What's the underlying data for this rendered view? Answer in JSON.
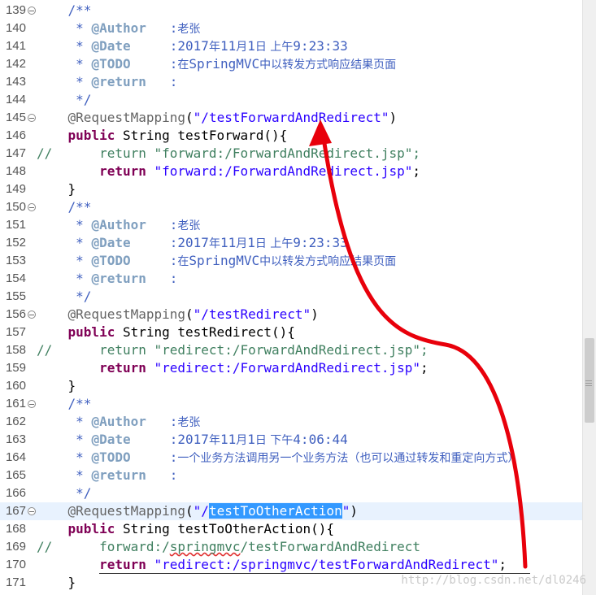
{
  "editor": {
    "lines": [
      {
        "num": "139",
        "fold": true,
        "tokens": [
          {
            "t": "    "
          },
          {
            "t": "/**",
            "c": "doc"
          }
        ]
      },
      {
        "num": "140",
        "tokens": [
          {
            "t": "     * ",
            "c": "doc"
          },
          {
            "t": "@Author",
            "c": "tag"
          },
          {
            "t": "   :",
            "c": "doc"
          },
          {
            "t": "老张",
            "c": "doc",
            "cjk": true
          }
        ]
      },
      {
        "num": "141",
        "tokens": [
          {
            "t": "     * ",
            "c": "doc"
          },
          {
            "t": "@Date",
            "c": "tag"
          },
          {
            "t": "     :2017",
            "c": "doc"
          },
          {
            "t": "年",
            "c": "doc",
            "cjk": true
          },
          {
            "t": "11",
            "c": "doc"
          },
          {
            "t": "月",
            "c": "doc",
            "cjk": true
          },
          {
            "t": "1",
            "c": "doc"
          },
          {
            "t": "日 上午",
            "c": "doc",
            "cjk": true
          },
          {
            "t": "9:23:33",
            "c": "doc"
          }
        ]
      },
      {
        "num": "142",
        "tokens": [
          {
            "t": "     * ",
            "c": "doc"
          },
          {
            "t": "@TODO",
            "c": "tag"
          },
          {
            "t": "     :",
            "c": "doc"
          },
          {
            "t": "在",
            "c": "doc",
            "cjk": true
          },
          {
            "t": "SpringMVC",
            "c": "doc"
          },
          {
            "t": "中以转发方式响应结果页面",
            "c": "doc",
            "cjk": true
          }
        ]
      },
      {
        "num": "143",
        "tokens": [
          {
            "t": "     * ",
            "c": "doc"
          },
          {
            "t": "@return",
            "c": "tag"
          },
          {
            "t": "   :",
            "c": "doc"
          }
        ]
      },
      {
        "num": "144",
        "tokens": [
          {
            "t": "     */",
            "c": "doc"
          }
        ]
      },
      {
        "num": "145",
        "fold": true,
        "tokens": [
          {
            "t": "    "
          },
          {
            "t": "@RequestMapping",
            "c": "ann"
          },
          {
            "t": "(",
            "c": "id"
          },
          {
            "t": "\"/testForwardAndRedirect\"",
            "c": "str"
          },
          {
            "t": ")",
            "c": "id"
          }
        ]
      },
      {
        "num": "146",
        "tokens": [
          {
            "t": "    "
          },
          {
            "t": "public",
            "c": "kw"
          },
          {
            "t": " String testForward(){",
            "c": "id"
          }
        ]
      },
      {
        "num": "147",
        "tokens": [
          {
            "t": "//      return \"forward:/ForwardAndRedirect.jsp\";",
            "c": "com"
          }
        ]
      },
      {
        "num": "148",
        "tokens": [
          {
            "t": "        "
          },
          {
            "t": "return",
            "c": "kw"
          },
          {
            "t": " ",
            "c": "id"
          },
          {
            "t": "\"forward:/ForwardAndRedirect.jsp\"",
            "c": "str"
          },
          {
            "t": ";",
            "c": "id"
          }
        ]
      },
      {
        "num": "149",
        "tokens": [
          {
            "t": "    }",
            "c": "id"
          }
        ]
      },
      {
        "num": "150",
        "fold": true,
        "tokens": [
          {
            "t": "    "
          },
          {
            "t": "/**",
            "c": "doc"
          }
        ]
      },
      {
        "num": "151",
        "tokens": [
          {
            "t": "     * ",
            "c": "doc"
          },
          {
            "t": "@Author",
            "c": "tag"
          },
          {
            "t": "   :",
            "c": "doc"
          },
          {
            "t": "老张",
            "c": "doc",
            "cjk": true
          }
        ]
      },
      {
        "num": "152",
        "tokens": [
          {
            "t": "     * ",
            "c": "doc"
          },
          {
            "t": "@Date",
            "c": "tag"
          },
          {
            "t": "     :2017",
            "c": "doc"
          },
          {
            "t": "年",
            "c": "doc",
            "cjk": true
          },
          {
            "t": "11",
            "c": "doc"
          },
          {
            "t": "月",
            "c": "doc",
            "cjk": true
          },
          {
            "t": "1",
            "c": "doc"
          },
          {
            "t": "日 上午",
            "c": "doc",
            "cjk": true
          },
          {
            "t": "9:23:33",
            "c": "doc"
          }
        ]
      },
      {
        "num": "153",
        "tokens": [
          {
            "t": "     * ",
            "c": "doc"
          },
          {
            "t": "@TODO",
            "c": "tag"
          },
          {
            "t": "     :",
            "c": "doc"
          },
          {
            "t": "在",
            "c": "doc",
            "cjk": true
          },
          {
            "t": "SpringMVC",
            "c": "doc"
          },
          {
            "t": "中以转发方式响应结果页面",
            "c": "doc",
            "cjk": true
          }
        ]
      },
      {
        "num": "154",
        "tokens": [
          {
            "t": "     * ",
            "c": "doc"
          },
          {
            "t": "@return",
            "c": "tag"
          },
          {
            "t": "   :",
            "c": "doc"
          }
        ]
      },
      {
        "num": "155",
        "tokens": [
          {
            "t": "     */",
            "c": "doc"
          }
        ]
      },
      {
        "num": "156",
        "fold": true,
        "tokens": [
          {
            "t": "    "
          },
          {
            "t": "@RequestMapping",
            "c": "ann"
          },
          {
            "t": "(",
            "c": "id"
          },
          {
            "t": "\"/testRedirect\"",
            "c": "str"
          },
          {
            "t": ")",
            "c": "id"
          }
        ]
      },
      {
        "num": "157",
        "tokens": [
          {
            "t": "    "
          },
          {
            "t": "public",
            "c": "kw"
          },
          {
            "t": " String testRedirect(){",
            "c": "id"
          }
        ]
      },
      {
        "num": "158",
        "tokens": [
          {
            "t": "//      return \"redirect:/ForwardAndRedirect.jsp\";",
            "c": "com"
          }
        ]
      },
      {
        "num": "159",
        "tokens": [
          {
            "t": "        "
          },
          {
            "t": "return",
            "c": "kw"
          },
          {
            "t": " ",
            "c": "id"
          },
          {
            "t": "\"redirect:/ForwardAndRedirect.jsp\"",
            "c": "str"
          },
          {
            "t": ";",
            "c": "id"
          }
        ]
      },
      {
        "num": "160",
        "tokens": [
          {
            "t": "    }",
            "c": "id"
          }
        ]
      },
      {
        "num": "161",
        "fold": true,
        "tokens": [
          {
            "t": "    "
          },
          {
            "t": "/**",
            "c": "doc"
          }
        ]
      },
      {
        "num": "162",
        "tokens": [
          {
            "t": "     * ",
            "c": "doc"
          },
          {
            "t": "@Author",
            "c": "tag"
          },
          {
            "t": "   :",
            "c": "doc"
          },
          {
            "t": "老张",
            "c": "doc",
            "cjk": true
          }
        ]
      },
      {
        "num": "163",
        "tokens": [
          {
            "t": "     * ",
            "c": "doc"
          },
          {
            "t": "@Date",
            "c": "tag"
          },
          {
            "t": "     :2017",
            "c": "doc"
          },
          {
            "t": "年",
            "c": "doc",
            "cjk": true
          },
          {
            "t": "11",
            "c": "doc"
          },
          {
            "t": "月",
            "c": "doc",
            "cjk": true
          },
          {
            "t": "1",
            "c": "doc"
          },
          {
            "t": "日 下午",
            "c": "doc",
            "cjk": true
          },
          {
            "t": "4:06:44",
            "c": "doc"
          }
        ]
      },
      {
        "num": "164",
        "tokens": [
          {
            "t": "     * ",
            "c": "doc"
          },
          {
            "t": "@TODO",
            "c": "tag"
          },
          {
            "t": "     :",
            "c": "doc"
          },
          {
            "t": "一个业务方法调用另一个业务方法（也可以通过转发和重定向方式）",
            "c": "doc",
            "cjk": true
          }
        ]
      },
      {
        "num": "165",
        "tokens": [
          {
            "t": "     * ",
            "c": "doc"
          },
          {
            "t": "@return",
            "c": "tag"
          },
          {
            "t": "   :",
            "c": "doc"
          }
        ]
      },
      {
        "num": "166",
        "tokens": [
          {
            "t": "     */",
            "c": "doc"
          }
        ]
      },
      {
        "num": "167",
        "fold": true,
        "current": true,
        "tokens": [
          {
            "t": "    "
          },
          {
            "t": "@RequestMapping",
            "c": "ann"
          },
          {
            "t": "(",
            "c": "id"
          },
          {
            "t": "\"/",
            "c": "str"
          },
          {
            "t": "testToOtherAction",
            "c": "sel"
          },
          {
            "t": "\"",
            "c": "str"
          },
          {
            "t": ")",
            "c": "id"
          }
        ]
      },
      {
        "num": "168",
        "tokens": [
          {
            "t": "    "
          },
          {
            "t": "public",
            "c": "kw"
          },
          {
            "t": " String testToOtherAction(){",
            "c": "id"
          }
        ]
      },
      {
        "num": "169",
        "tokens": [
          {
            "t": "//      forward:/",
            "c": "com"
          },
          {
            "t": "springmvc",
            "c": "com",
            "squig": true
          },
          {
            "t": "/testForwardAndRedirect",
            "c": "com"
          }
        ]
      },
      {
        "num": "170",
        "tokens": [
          {
            "t": "        "
          },
          {
            "t": "return",
            "c": "kw"
          },
          {
            "t": " ",
            "c": "id"
          },
          {
            "t": "\"redirect:/springmvc/testForwardAndRedirect\"",
            "c": "str"
          },
          {
            "t": ";",
            "c": "id"
          }
        ]
      },
      {
        "num": "171",
        "tokens": [
          {
            "t": "    }",
            "c": "id"
          }
        ]
      }
    ]
  },
  "watermark": "http://blog.csdn.net/dl0246",
  "colors": {
    "annotation_arrow": "#e8000b",
    "selection": "#3399ff",
    "current_line": "#e8f2fe"
  }
}
